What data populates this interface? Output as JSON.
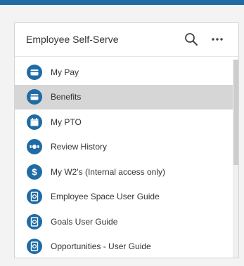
{
  "colors": {
    "accent": "#1f6ba5",
    "selected_row": "#d6d6d6"
  },
  "widget": {
    "title": "Employee Self-Serve",
    "actions": {
      "search_icon": "search-icon",
      "more_icon": "more-horizontal-icon"
    }
  },
  "items": [
    {
      "label": "My Pay",
      "icon": "wallet-icon"
    },
    {
      "label": "Benefits",
      "icon": "wallet-icon",
      "selected": true
    },
    {
      "label": "My PTO",
      "icon": "calendar-icon"
    },
    {
      "label": "Review History",
      "icon": "feedback-icon"
    },
    {
      "label": "My W2's (Internal access only)",
      "icon": "dollar-icon"
    },
    {
      "label": "Employee Space User Guide",
      "icon": "guide-icon"
    },
    {
      "label": "Goals User Guide",
      "icon": "guide-icon"
    },
    {
      "label": "Opportunities - User Guide",
      "icon": "guide-icon"
    }
  ]
}
